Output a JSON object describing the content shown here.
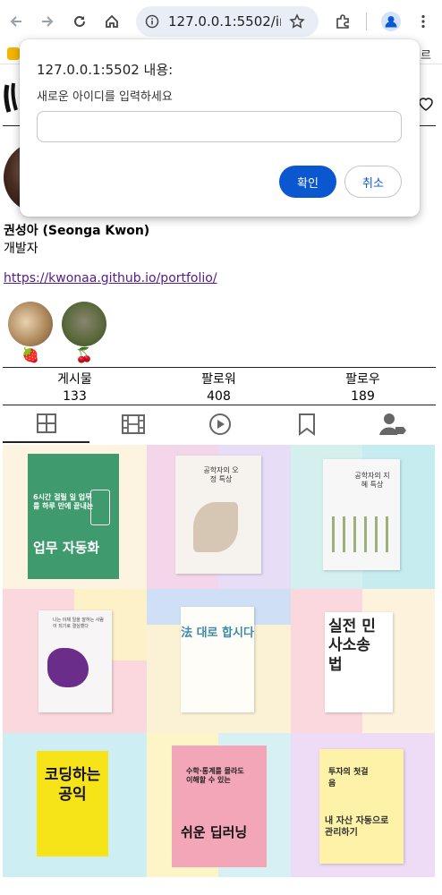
{
  "browser": {
    "url": "127.0.0.1:5502/ind...",
    "icons": [
      "back-icon",
      "forward-icon",
      "reload-icon",
      "home-icon",
      "site-info-icon",
      "bookmark-star-icon",
      "extensions-icon",
      "profile-icon",
      "menu-icon"
    ],
    "bookmark_partial_text": "르"
  },
  "prompt_dialog": {
    "origin": "127.0.0.1:5502 내용:",
    "message": "새로운 아이디를 입력하세요",
    "input_value": "",
    "ok_label": "확인",
    "cancel_label": "취소"
  },
  "profile": {
    "name": "권성아 (Seonga Kwon)",
    "bio": "개발자",
    "link": "https://kwonaa.github.io/portfolio/",
    "highlights": [
      {
        "label": "",
        "icon": "strawberry-icon"
      },
      {
        "label": "",
        "icon": "cherry-icon"
      }
    ],
    "stats": [
      {
        "label": "게시물",
        "value": "133"
      },
      {
        "label": "팔로워",
        "value": "408"
      },
      {
        "label": "팔로우",
        "value": "189"
      }
    ]
  },
  "tabs": [
    "grid-icon",
    "reels-film-icon",
    "play-icon",
    "saved-bookmark-icon",
    "tagged-person-icon"
  ],
  "posts": [
    {
      "title": "업무 자동화",
      "subtitle": "6시간 걸릴 일 업무를 하루 만에 끝내는",
      "bg": "#fdf3e1",
      "cover": "#3f9a6e"
    },
    {
      "title": "공학자의 오정 특상",
      "subtitle": "",
      "bg": "#e7ddf7",
      "cover": "#f6f3ee"
    },
    {
      "title": "공학자의 지혜 특상",
      "subtitle": "",
      "bg": "#d4f0ee",
      "cover": "#f7f7f7"
    },
    {
      "title": "",
      "subtitle": "나는 이제 일을 잘하는 사람이 되기로 결심했다",
      "bg": "#fbd7de",
      "cover": "#f8f5f6"
    },
    {
      "title": "法 대로 합시다",
      "subtitle": "",
      "bg": "#fbf2d6",
      "cover": "#fffdf7"
    },
    {
      "title": "실전 민사소송 법",
      "subtitle": "",
      "bg": "#fdf3dd",
      "cover": "#ffffff"
    },
    {
      "title": "코딩하는 공익",
      "subtitle": "",
      "bg": "#cdeef3",
      "cover": "#f6e418"
    },
    {
      "title": "쉬운 딥러닝",
      "subtitle": "수학·통계를 몰라도 이해할 수 있는",
      "bg": "#fdf4c8",
      "cover": "#f2a6b8"
    },
    {
      "title": "내 자산 자동으로 관리하기",
      "subtitle": "투자의 첫걸음",
      "bg": "#eedcf6",
      "cover": "#fdf2a8"
    }
  ]
}
